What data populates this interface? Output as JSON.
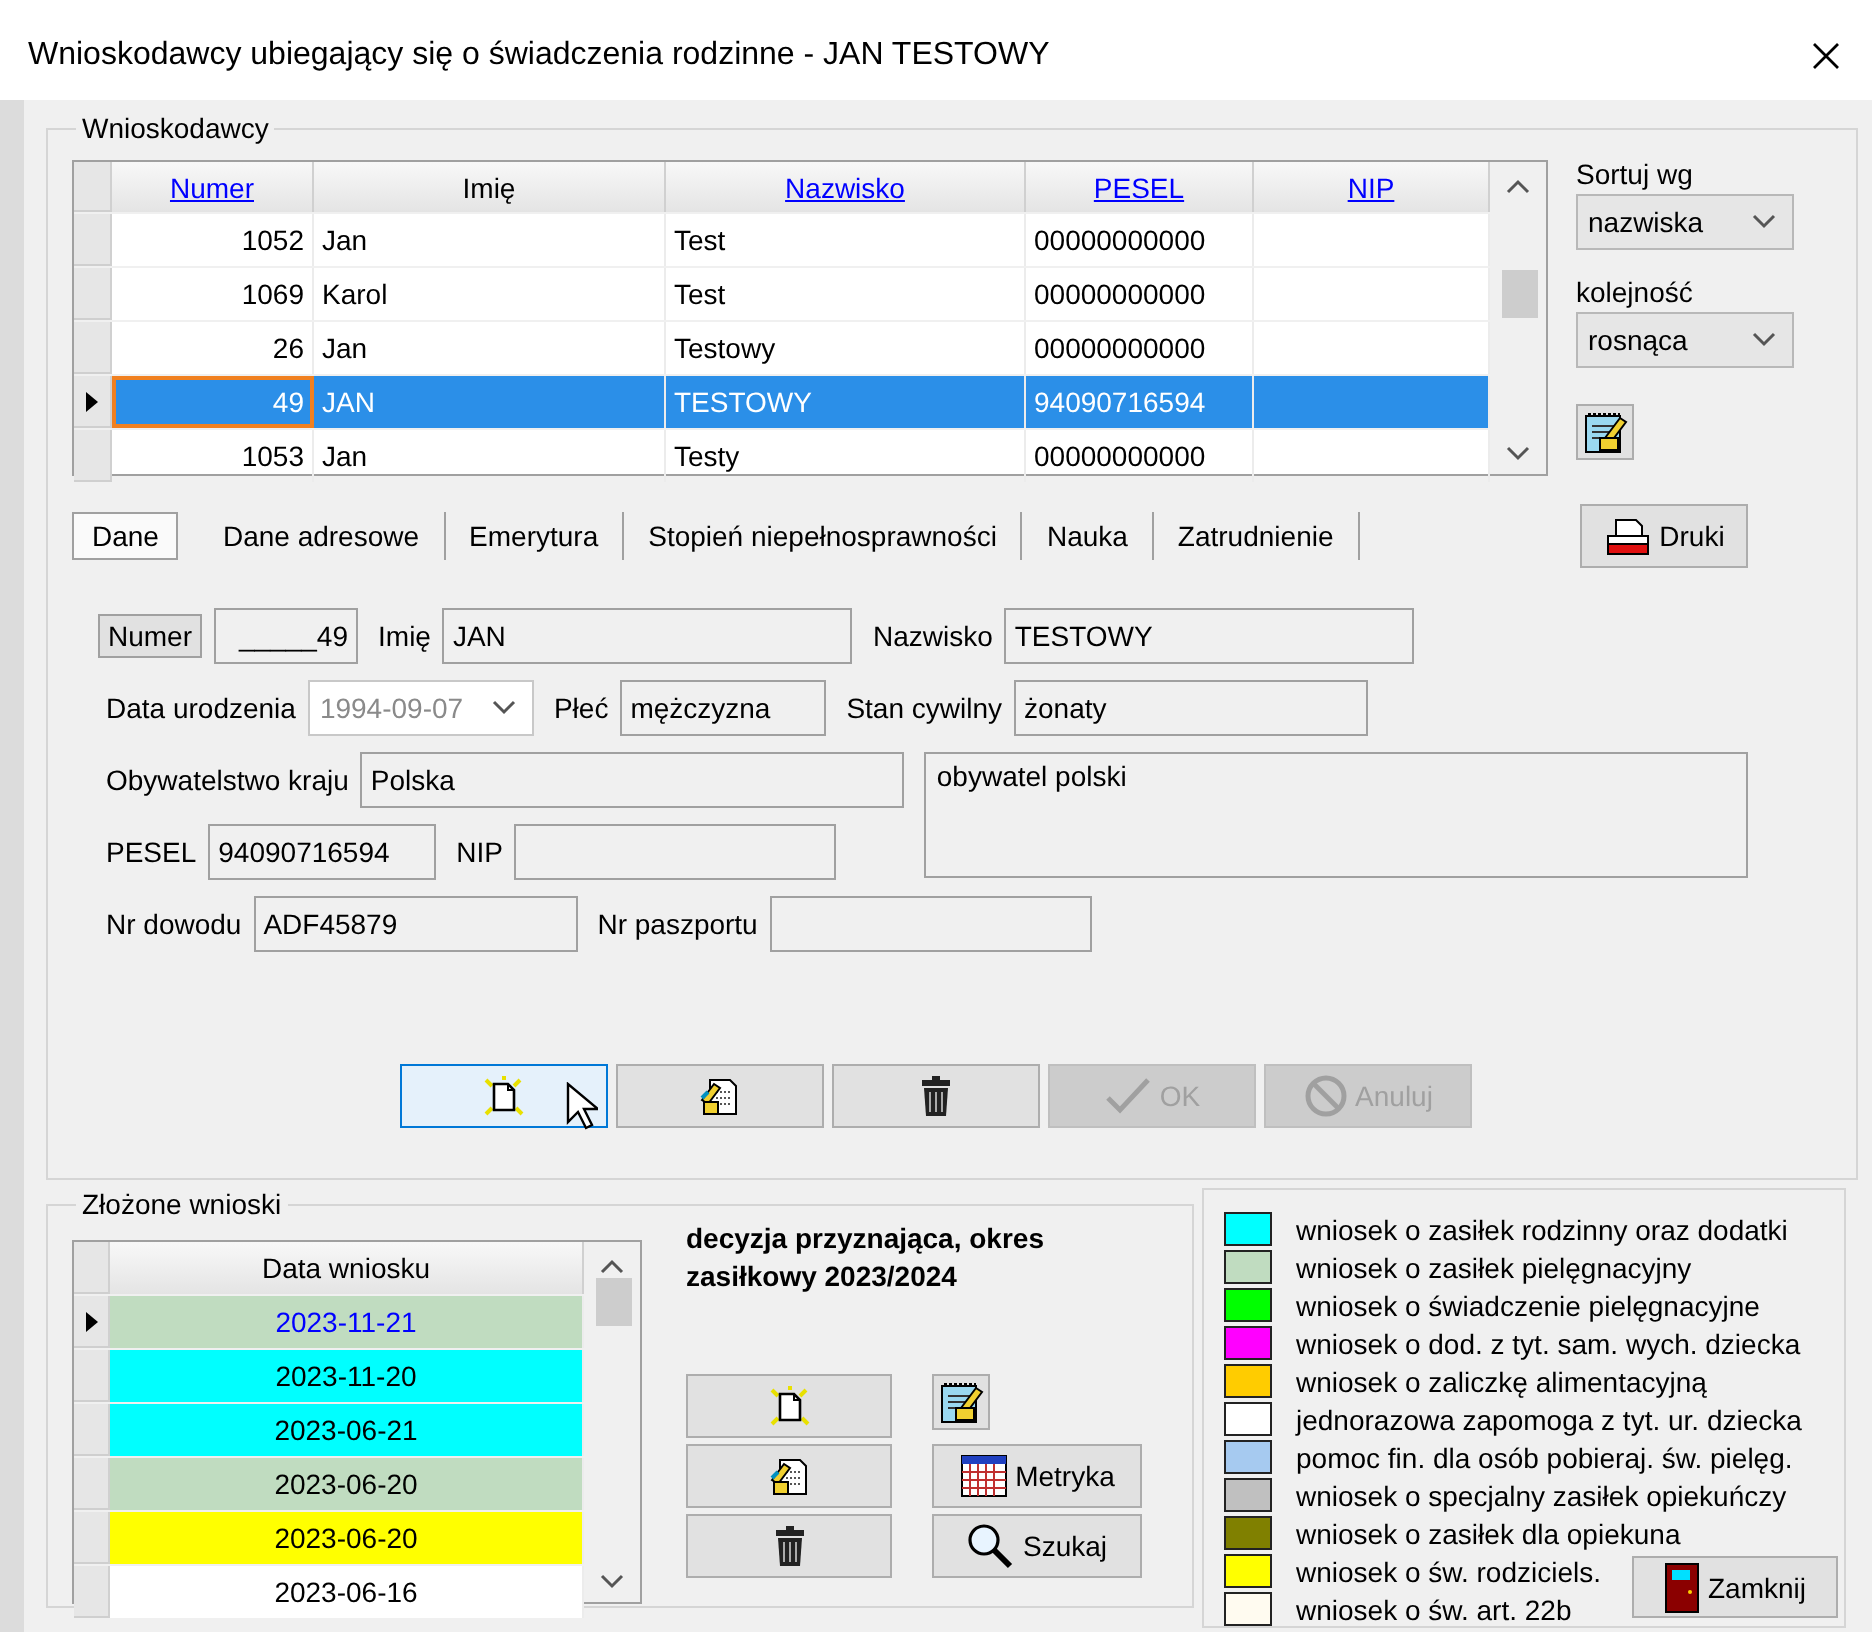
{
  "window": {
    "title": "Wnioskodawcy ubiegający się o świadczenia rodzinne - JAN TESTOWY"
  },
  "applicants": {
    "title": "Wnioskodawcy",
    "columns": [
      {
        "label": "Numer",
        "sortable": true
      },
      {
        "label": "Imię",
        "sortable": false
      },
      {
        "label": "Nazwisko",
        "sortable": true
      },
      {
        "label": "PESEL",
        "sortable": true
      },
      {
        "label": "NIP",
        "sortable": true
      }
    ],
    "rows": [
      {
        "cells": [
          "1052",
          "Jan",
          "Test",
          "00000000000"
        ],
        "selected": false
      },
      {
        "cells": [
          "1069",
          "Karol",
          "Test",
          "00000000000"
        ],
        "selected": false
      },
      {
        "cells": [
          "26",
          "Jan",
          "Testowy",
          "00000000000"
        ],
        "selected": false
      },
      {
        "cells": [
          "49",
          "JAN",
          "TESTOWY",
          "94090716594"
        ],
        "selected": true
      },
      {
        "cells": [
          "1053",
          "Jan",
          "Testy",
          "00000000000"
        ],
        "selected": false
      }
    ]
  },
  "sort": {
    "label": "Sortuj wg",
    "value": "nazwiska"
  },
  "order": {
    "label": "kolejność",
    "value": "rosnąca"
  },
  "tabs": [
    {
      "label": "Dane",
      "selected": true
    },
    {
      "label": "Dane adresowe",
      "selected": false
    },
    {
      "label": "Emerytura",
      "selected": false
    },
    {
      "label": "Stopień niepełnosprawności",
      "selected": false
    },
    {
      "label": "Nauka",
      "selected": false
    },
    {
      "label": "Zatrudnienie",
      "selected": false
    }
  ],
  "print_button": {
    "label": "Druki"
  },
  "form": {
    "rows": [
      [
        {
          "kind": "tag",
          "text": "Numer"
        },
        {
          "kind": "field",
          "value": "_____49"
        },
        {
          "kind": "label",
          "text": "Imię"
        },
        {
          "kind": "field",
          "value": "JAN"
        },
        {
          "kind": "label",
          "text": "Nazwisko"
        },
        {
          "kind": "field",
          "value": "TESTOWY"
        }
      ],
      [
        {
          "kind": "label",
          "text": "Data urodzenia"
        },
        {
          "kind": "combo",
          "value": "1994-09-07",
          "disabled": true
        },
        {
          "kind": "label",
          "text": "Płeć"
        },
        {
          "kind": "field",
          "value": "mężczyzna"
        },
        {
          "kind": "label",
          "text": "Stan cywilny"
        },
        {
          "kind": "field",
          "value": "żonaty"
        }
      ],
      [
        {
          "kind": "label",
          "text": "Obywatelstwo kraju"
        },
        {
          "kind": "field",
          "value": "Polska"
        }
      ],
      [
        {
          "kind": "label",
          "text": "PESEL"
        },
        {
          "kind": "field",
          "value": "94090716594"
        },
        {
          "kind": "label",
          "text": "NIP"
        },
        {
          "kind": "field"
        }
      ],
      [
        {
          "kind": "label",
          "text": "Nr dowodu"
        },
        {
          "kind": "field",
          "value": "ADF45879"
        },
        {
          "kind": "label",
          "text": "Nr paszportu"
        },
        {
          "kind": "field"
        }
      ]
    ],
    "memo": "obywatel polski"
  },
  "actions": [
    {
      "kind": "new",
      "focused": true,
      "disabled": false
    },
    {
      "kind": "edit",
      "focused": false,
      "disabled": false
    },
    {
      "kind": "delete",
      "focused": false,
      "disabled": false
    },
    {
      "kind": "ok",
      "label": "OK",
      "focused": false,
      "disabled": true
    },
    {
      "kind": "cancel",
      "label": "Anuluj",
      "focused": false,
      "disabled": true
    }
  ],
  "applications": {
    "title": "Złożone wnioski",
    "column": "Data wniosku",
    "rows": [
      {
        "date": "2023-11-21",
        "color": "#c0dcc0",
        "selected": true
      },
      {
        "date": "2023-11-20",
        "color": "#00ffff",
        "selected": false
      },
      {
        "date": "2023-06-21",
        "color": "#00ffff",
        "selected": false
      },
      {
        "date": "2023-06-20",
        "color": "#c0dcc0",
        "selected": false
      },
      {
        "date": "2023-06-20",
        "color": "#ffff00",
        "selected": false
      },
      {
        "date": "2023-06-16",
        "color": "#ffffff",
        "selected": false
      }
    ]
  },
  "decision": "decyzja przyznająca, okres zasiłkowy 2023/2024",
  "application_actions": [
    {
      "kind": "new"
    },
    {
      "kind": "edit"
    },
    {
      "kind": "delete"
    }
  ],
  "side_actions": [
    {
      "kind": "notes"
    },
    {
      "kind": "register",
      "label": "Metryka"
    },
    {
      "kind": "search",
      "label": "Szukaj"
    }
  ],
  "legend": [
    {
      "label": "wniosek o zasiłek rodzinny oraz dodatki",
      "color": "#00ffff"
    },
    {
      "label": "wniosek o zasiłek pielęgnacyjny",
      "color": "#c0dcc0"
    },
    {
      "label": "wniosek o świadczenie pielęgnacyjne",
      "color": "#00ff00"
    },
    {
      "label": "wniosek o dod. z tyt. sam. wych. dziecka",
      "color": "#ff00ff"
    },
    {
      "label": "wniosek o zaliczkę alimentacyjną",
      "color": "#ffcc00"
    },
    {
      "label": "jednorazowa zapomoga z tyt. ur. dziecka",
      "color": "#ffffff"
    },
    {
      "label": "pomoc fin. dla osób pobieraj. św. pielęg.",
      "color": "#a6caf0"
    },
    {
      "label": "wniosek o specjalny zasiłek opiekuńczy",
      "color": "#c0c0c0"
    },
    {
      "label": "wniosek o zasiłek dla opiekuna",
      "color": "#808000"
    },
    {
      "label": "wniosek o św. rodziciels.",
      "color": "#ffff00"
    },
    {
      "label": "wniosek o św. art. 22b",
      "color": "#fffbf0"
    }
  ],
  "close_button": {
    "label": "Zamknij"
  }
}
